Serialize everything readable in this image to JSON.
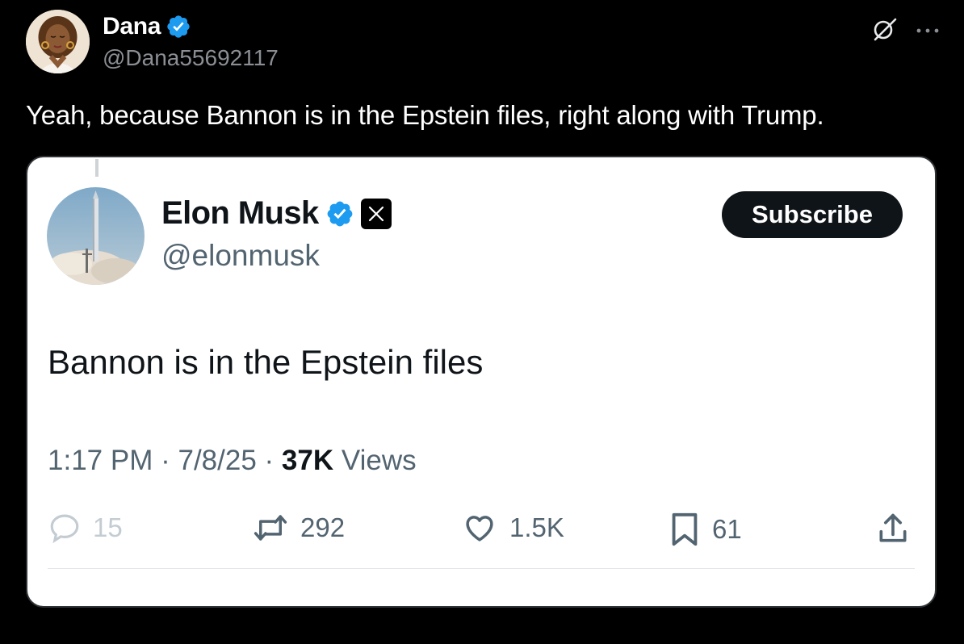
{
  "post": {
    "author_name": "Dana",
    "author_handle": "@Dana55692117",
    "text": "Yeah, because Bannon is in the Epstein files, right along with Trump.",
    "icons": [
      "grok-icon",
      "more-icon"
    ]
  },
  "quoted": {
    "author_name": "Elon Musk",
    "author_handle": "@elonmusk",
    "subscribe_label": "Subscribe",
    "text": "Bannon is in the Epstein files",
    "time": "1:17 PM",
    "date": "7/8/25",
    "views_count": "37K",
    "views_label": "Views",
    "separator": "·",
    "stats": {
      "replies": "15",
      "reposts": "292",
      "likes": "1.5K",
      "bookmarks": "61"
    }
  },
  "colors": {
    "verified_blue": "#1d9bf0",
    "background": "#000000",
    "card": "#ffffff",
    "muted": "#536471"
  }
}
